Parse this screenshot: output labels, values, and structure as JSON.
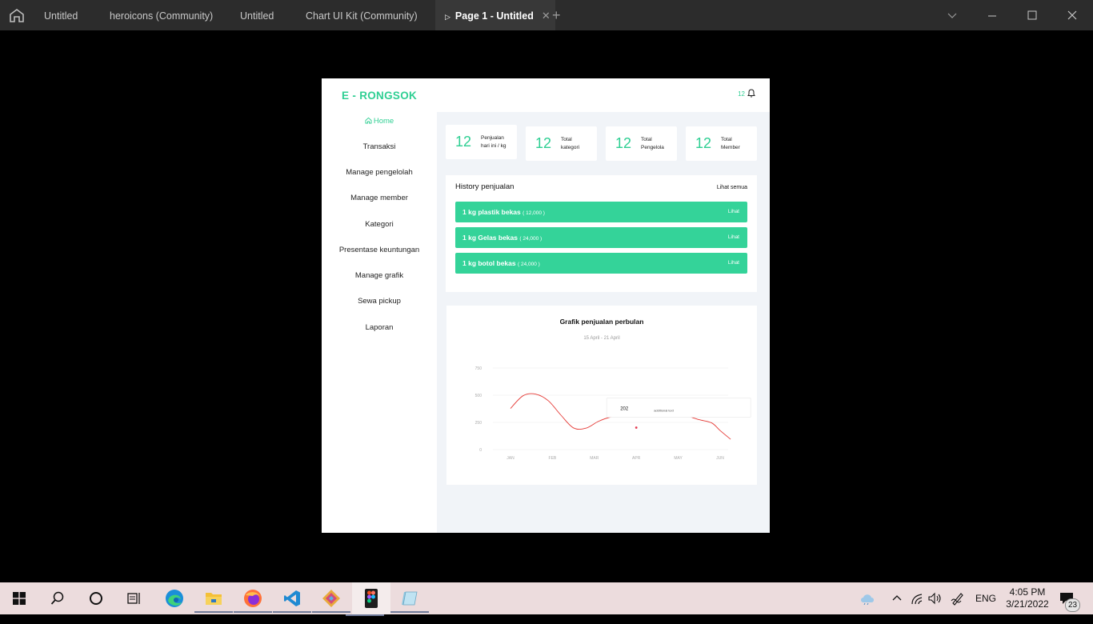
{
  "tabs": [
    {
      "label": "Untitled"
    },
    {
      "label": "heroicons (Community)"
    },
    {
      "label": "Untitled"
    },
    {
      "label": "Chart UI Kit (Community)"
    },
    {
      "label": "Page 1 - Untitled"
    }
  ],
  "app": {
    "brand": "E - RONGSOK",
    "notification_count": "12"
  },
  "sidebar": {
    "items": [
      {
        "label": "Home"
      },
      {
        "label": "Transaksi"
      },
      {
        "label": "Manage pengelolah"
      },
      {
        "label": "Manage member"
      },
      {
        "label": "Kategori"
      },
      {
        "label": "Presentase keuntungan"
      },
      {
        "label": "Manage grafik"
      },
      {
        "label": "Sewa pickup"
      },
      {
        "label": "Laporan"
      }
    ]
  },
  "stats": [
    {
      "value": "12",
      "label1": "Penjualan",
      "label2": "hari ini / kg"
    },
    {
      "value": "12",
      "label1": "Total",
      "label2": "kategori"
    },
    {
      "value": "12",
      "label1": "Total",
      "label2": "Pengelola"
    },
    {
      "value": "12",
      "label1": "Total",
      "label2": "Member"
    }
  ],
  "history": {
    "title": "History penjualan",
    "see_all": "Lihat semua",
    "rows": [
      {
        "text": "1 kg plastik bekas",
        "qty": "( 12,000 )",
        "action": "Lihat"
      },
      {
        "text": "1 kg Gelas bekas",
        "qty": "( 24,000 )",
        "action": "Lihat"
      },
      {
        "text": "1 kg botol bekas",
        "qty": "( 24,000 )",
        "action": "Lihat"
      }
    ]
  },
  "chart": {
    "title": "Grafik penjualan perbulan",
    "subtitle": "15 April - 21 April",
    "tooltip_value": "202",
    "tooltip_text": "additional text"
  },
  "chart_data": {
    "type": "line",
    "categories": [
      "JAN",
      "FEB",
      "MAR",
      "APR",
      "MAY",
      "JUN"
    ],
    "x": [
      0.0,
      0.3,
      0.6,
      0.9,
      1.2,
      1.5,
      1.8,
      2.1,
      2.4,
      2.7,
      3.0,
      3.3,
      3.6,
      3.9,
      4.2,
      4.5,
      4.8,
      5.0,
      5.25
    ],
    "y": [
      378,
      495,
      510,
      450,
      318,
      200,
      197,
      260,
      300,
      305,
      327,
      333,
      327,
      332,
      310,
      275,
      245,
      175,
      95
    ],
    "yticks": [
      0,
      250,
      500,
      750
    ],
    "ylim": [
      0,
      750
    ],
    "highlight_point": {
      "x": 3.0,
      "y": 202
    },
    "color": "#e53935",
    "grid": true
  },
  "taskbar": {
    "language": "ENG",
    "time": "4:05 PM",
    "date": "3/21/2022",
    "notifications": "23"
  }
}
